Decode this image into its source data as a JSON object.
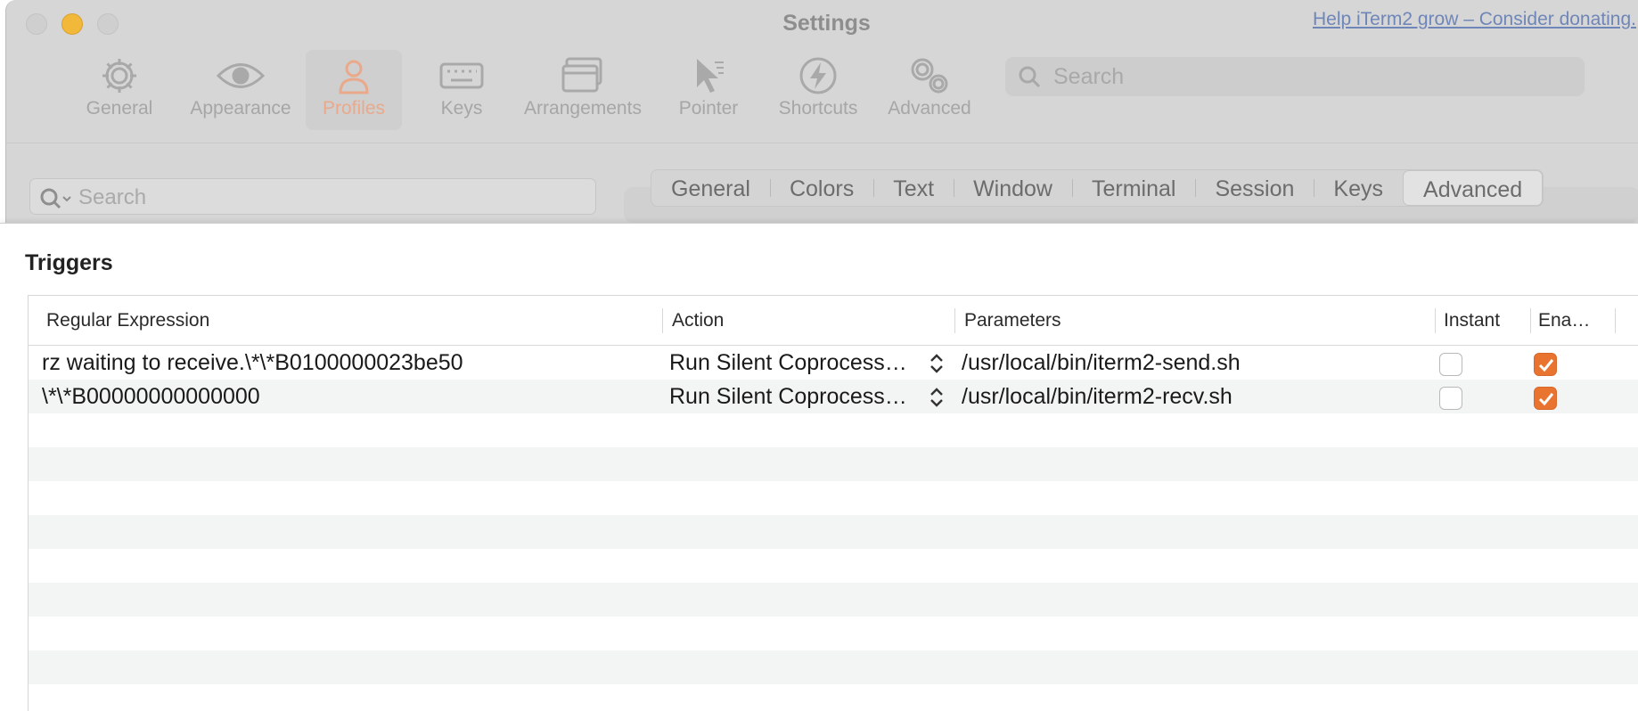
{
  "window": {
    "title": "Settings",
    "donate_link": "Help iTerm2 grow – Consider donating."
  },
  "toolbar": {
    "items": [
      {
        "label": "General",
        "icon": "gear-icon"
      },
      {
        "label": "Appearance",
        "icon": "eye-icon"
      },
      {
        "label": "Profiles",
        "icon": "person-icon",
        "selected": true
      },
      {
        "label": "Keys",
        "icon": "keyboard-icon"
      },
      {
        "label": "Arrangements",
        "icon": "windows-icon"
      },
      {
        "label": "Pointer",
        "icon": "pointer-icon"
      },
      {
        "label": "Shortcuts",
        "icon": "bolt-icon"
      },
      {
        "label": "Advanced",
        "icon": "gears-icon"
      }
    ],
    "search_placeholder": "Search"
  },
  "profiles": {
    "search_placeholder": "Search",
    "tabs": [
      "General",
      "Colors",
      "Text",
      "Window",
      "Terminal",
      "Session",
      "Keys",
      "Advanced"
    ],
    "active_tab": "Advanced"
  },
  "triggers": {
    "title": "Triggers",
    "columns": [
      "Regular Expression",
      "Action",
      "Parameters",
      "Instant",
      "Ena…"
    ],
    "rows": [
      {
        "regex": "rz waiting to receive.\\*\\*B0100000023be50",
        "action": "Run Silent Coprocess…",
        "parameters": "/usr/local/bin/iterm2-send.sh",
        "instant": false,
        "enabled": true
      },
      {
        "regex": "\\*\\*B00000000000000",
        "action": "Run Silent Coprocess…",
        "parameters": "/usr/local/bin/iterm2-recv.sh",
        "instant": false,
        "enabled": true
      }
    ]
  },
  "colors": {
    "accent": "#e8742f",
    "minimize": "#f1b83a",
    "link": "#6f86b8"
  }
}
